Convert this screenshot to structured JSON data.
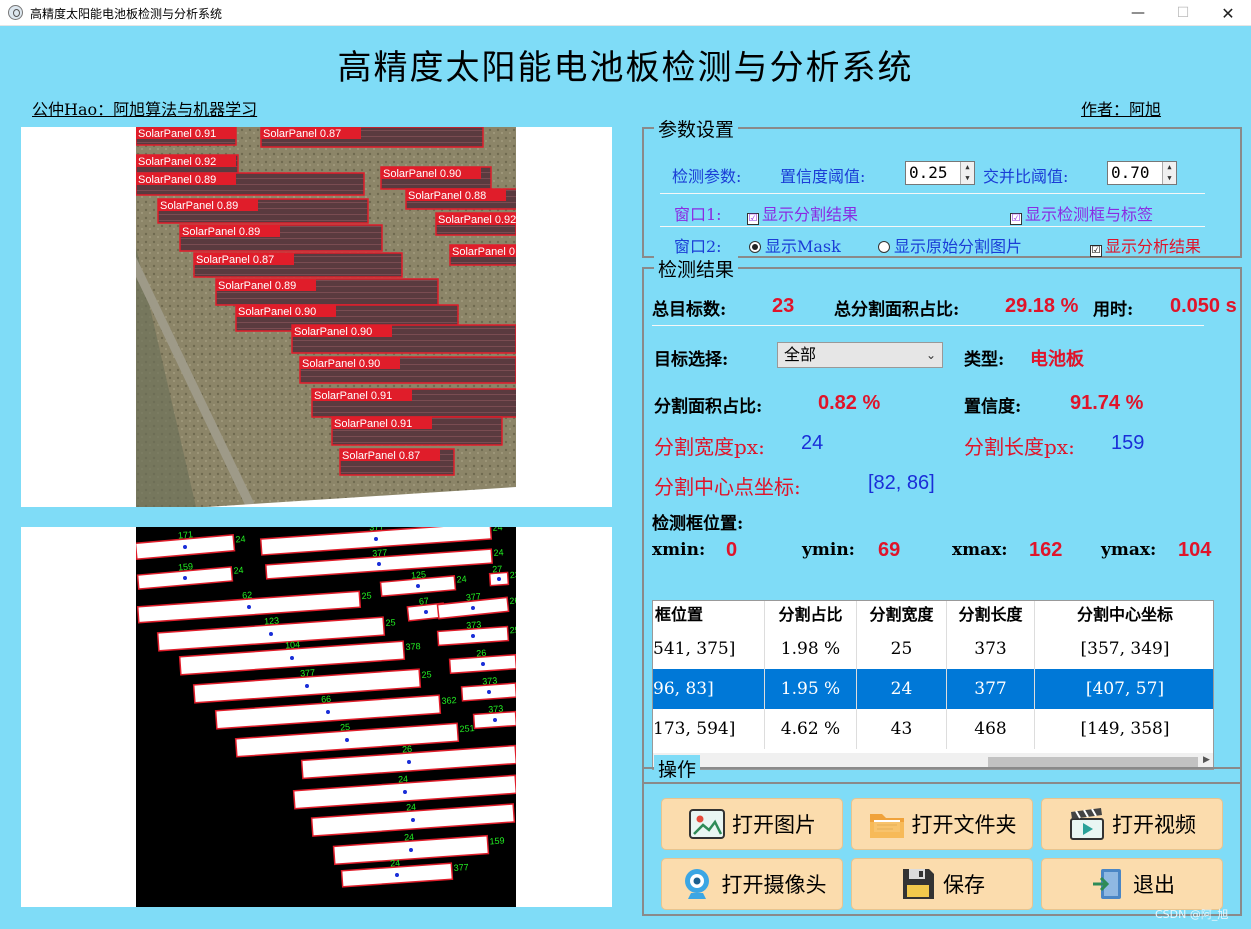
{
  "window": {
    "title": "高精度太阳能电池板检测与分析系统",
    "min_glyph": "—",
    "max_glyph": "☐",
    "close_glyph": "✕"
  },
  "header": {
    "title": "高精度太阳能电池板检测与分析系统",
    "left_link": "公仲Hao：阿旭算法与机器学习",
    "right_link": "作者：阿旭"
  },
  "images": {
    "top_label_text": "SolarPanel",
    "top_detections": [
      "SolarPanel 0.91",
      "SolarPanel 0.87",
      "SolarPanel 0.92",
      "SolarPanel 0.90",
      "SolarPanel 0.89",
      "SolarPanel 0.88",
      "SolarPanel 0.89",
      "SolarPanel 0.92",
      "SolarPanel 0.89",
      "SolarPanel 0.89",
      "SolarPanel 0.87",
      "SolarPanel 0.89",
      "SolarPanel 0.90",
      "SolarPanel 0.90",
      "SolarPanel 0.90",
      "SolarPanel 0.91"
    ],
    "mask_labels": [
      "171",
      "24",
      "377",
      "24",
      "159",
      "24",
      "377",
      "24",
      "125",
      "24",
      "27",
      "23",
      "62",
      "25",
      "67",
      "25",
      "377",
      "26",
      "123",
      "25",
      "373",
      "25",
      "104",
      "378",
      "26",
      "88",
      "377",
      "25",
      "373",
      "25",
      "66",
      "362",
      "373",
      "316",
      "25",
      "251",
      "26",
      "156",
      "24"
    ]
  },
  "params": {
    "title": "参数设置",
    "detect_label": "检测参数:",
    "conf_label": "置信度阈值:",
    "conf_value": "0.25",
    "iou_label": "交并比阈值:",
    "iou_value": "0.70",
    "win1_label": "窗口1:",
    "win1_opt1": "显示分割结果",
    "win1_opt2": "显示检测框与标签",
    "win2_label": "窗口2:",
    "win2_opt1": "显示Mask",
    "win2_opt2": "显示原始分割图片",
    "win2_opt3": "显示分析结果",
    "check_glyph": "☑"
  },
  "results": {
    "title": "检测结果",
    "total_label": "总目标数:",
    "total_value": "23",
    "area_label": "总分割面积占比:",
    "area_value": "29.18 %",
    "time_label": "用时:",
    "time_value": "0.050 s",
    "target_label": "目标选择:",
    "target_value": "全部",
    "type_label": "类型:",
    "type_value": "电池板",
    "seg_area_label": "分割面积占比:",
    "seg_area_value": "0.82 %",
    "conf_label": "置信度:",
    "conf_value": "91.74 %",
    "width_label": "分割宽度px:",
    "width_value": "24",
    "length_label": "分割长度px:",
    "length_value": "159",
    "center_label": "分割中心点坐标:",
    "center_value": "[82, 86]",
    "box_label": "检测框位置:",
    "xmin_label": "xmin:",
    "xmin_value": "0",
    "ymin_label": "ymin:",
    "ymin_value": "69",
    "xmax_label": "xmax:",
    "xmax_value": "162",
    "ymax_label": "ymax:",
    "ymax_value": "104",
    "table": {
      "headers": [
        "框位置",
        "分割占比",
        "分割宽度",
        "分割长度",
        "分割中心坐标"
      ],
      "rows": [
        [
          "541, 375]",
          "1.98 %",
          "25",
          "373",
          "[357, 349]"
        ],
        [
          "96, 83]",
          "1.95 %",
          "24",
          "377",
          "[407, 57]"
        ],
        [
          "173, 594]",
          "4.62 %",
          "43",
          "468",
          "[149, 358]"
        ]
      ],
      "selected_row": 1
    }
  },
  "ops": {
    "title": "操作",
    "open_image": "打开图片",
    "open_folder": "打开文件夹",
    "open_video": "打开视频",
    "open_camera": "打开摄像头",
    "save": "保存",
    "exit": "退出"
  },
  "watermark": "CSDN @阿_旭"
}
